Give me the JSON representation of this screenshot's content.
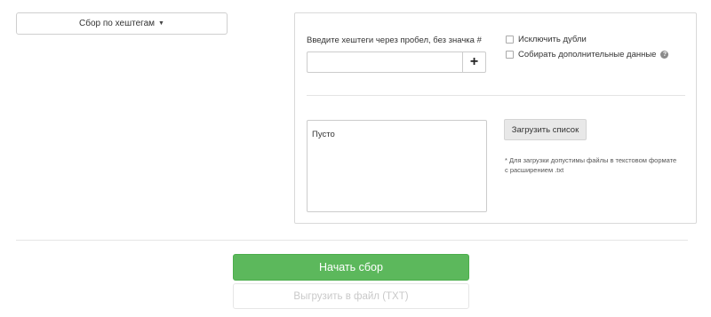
{
  "mode_dropdown": {
    "label": "Сбор по хештегам"
  },
  "hashtag_input": {
    "hint": "Введите хештеги через пробел, без значка #",
    "value": "",
    "add_label": "+"
  },
  "options": {
    "exclude_duplicates": {
      "label": "Исключить дубли",
      "checked": false
    },
    "collect_extra": {
      "label": "Собирать дополнительные данные",
      "checked": false,
      "help_icon": "question-circle-icon"
    }
  },
  "list_area": {
    "text": "Пусто"
  },
  "load_button": {
    "label": "Загрузить список"
  },
  "load_note": "* Для загрузки допустимы файлы в текстовом формате с расширением .txt",
  "start_button": {
    "label": "Начать сбор",
    "color": "#5cb85c"
  },
  "export_button": {
    "label": "Выгрузить в файл (TXT)",
    "disabled": true
  }
}
